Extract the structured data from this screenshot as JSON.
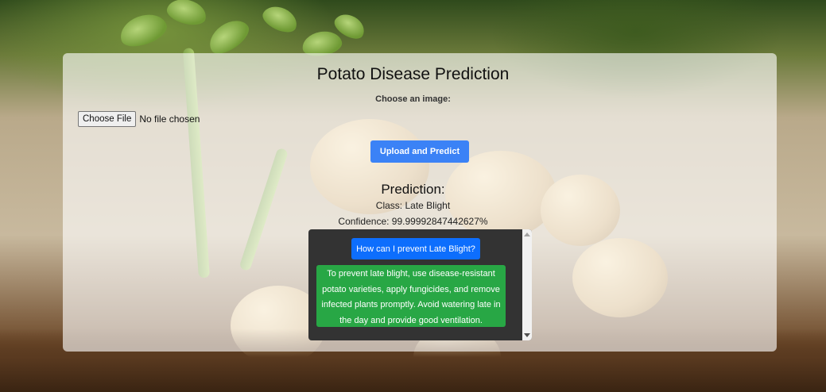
{
  "page": {
    "title": "Potato Disease Prediction"
  },
  "upload": {
    "choose_label": "Choose an image:",
    "file_button_label": "Choose File",
    "file_status": "No file chosen",
    "submit_label": "Upload and Predict"
  },
  "prediction": {
    "heading": "Prediction:",
    "class_text": "Class: Late Blight",
    "confidence_text": "Confidence: 99.99992847442627%"
  },
  "chat": {
    "question": "How can I prevent Late Blight?",
    "answer": "To prevent late blight, use disease-resistant potato varieties, apply fungicides, and remove infected plants promptly. Avoid watering late in the day and provide good ventilation."
  },
  "colors": {
    "primary_button": "#3b82f6",
    "question_bubble": "#0d6efd",
    "answer_bubble": "#28a745",
    "chat_background": "#333333"
  }
}
